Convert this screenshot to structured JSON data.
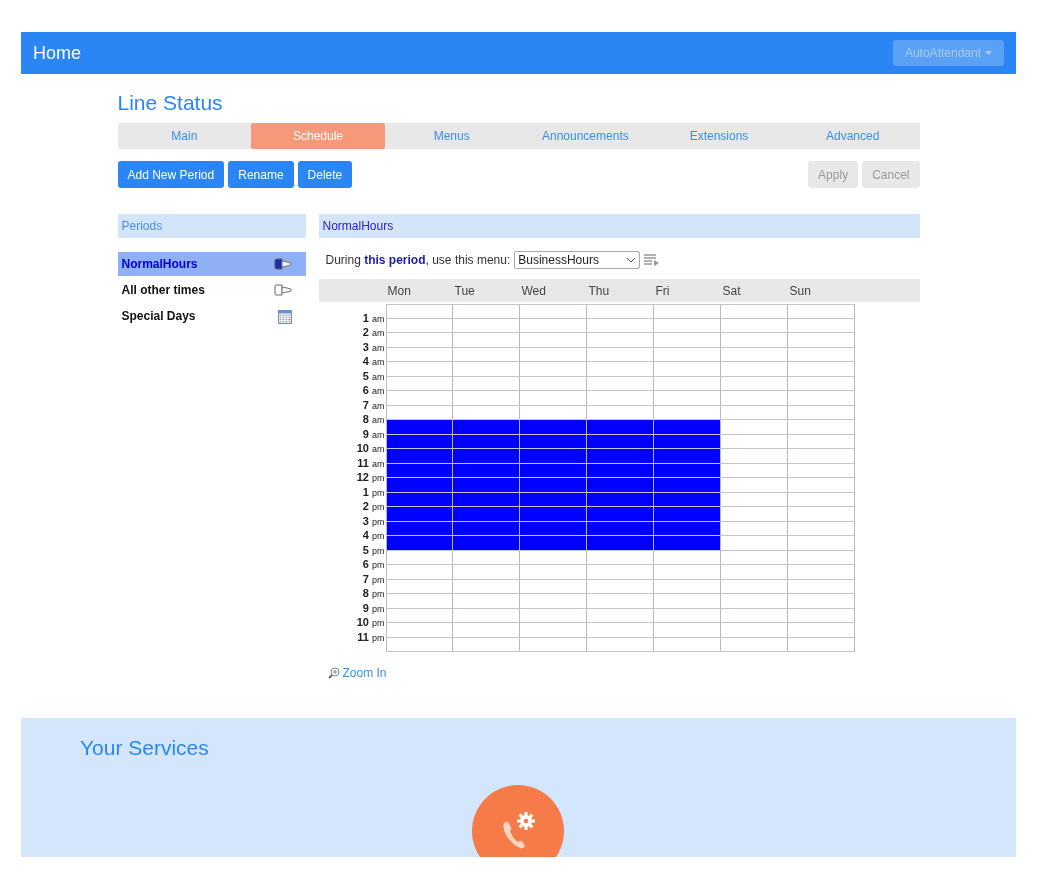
{
  "topbar": {
    "title": "Home",
    "menu": "AutoAttendant"
  },
  "page_title": "Line Status",
  "tabs": [
    {
      "label": "Main",
      "selected": false
    },
    {
      "label": "Schedule",
      "selected": true
    },
    {
      "label": "Menus",
      "selected": false
    },
    {
      "label": "Announcements",
      "selected": false
    },
    {
      "label": "Extensions",
      "selected": false
    },
    {
      "label": "Advanced",
      "selected": false
    }
  ],
  "actions": [
    {
      "label": "Add New Period",
      "disabled": false
    },
    {
      "label": "Rename",
      "disabled": false
    },
    {
      "label": "Delete",
      "disabled": false
    }
  ],
  "form_buttons": [
    {
      "label": "Apply",
      "disabled": true
    },
    {
      "label": "Cancel",
      "disabled": true
    }
  ],
  "periods": {
    "header": "Periods",
    "items": [
      {
        "label": "NormalHours",
        "kind": "brush",
        "selected": true
      },
      {
        "label": "All other times",
        "kind": "brush",
        "selected": false
      },
      {
        "label": "Special Days",
        "kind": "calendar",
        "selected": false
      }
    ]
  },
  "period_panel": {
    "header": "NormalHours",
    "sentence": "During **this period**, use this menu:",
    "menu_value": "BusinessHours"
  },
  "schedule": {
    "hours": [
      {
        "num": "1",
        "suffix": "am"
      },
      {
        "num": "2",
        "suffix": "am"
      },
      {
        "num": "3",
        "suffix": "am"
      },
      {
        "num": "4",
        "suffix": "am"
      },
      {
        "num": "5",
        "suffix": "am"
      },
      {
        "num": "6",
        "suffix": "am"
      },
      {
        "num": "7",
        "suffix": "am"
      },
      {
        "num": "8",
        "suffix": "am"
      },
      {
        "num": "9",
        "suffix": "am"
      },
      {
        "num": "10",
        "suffix": "am"
      },
      {
        "num": "11",
        "suffix": "am"
      },
      {
        "num": "12",
        "suffix": "pm"
      },
      {
        "num": "1",
        "suffix": "pm"
      },
      {
        "num": "2",
        "suffix": "pm"
      },
      {
        "num": "3",
        "suffix": "pm"
      },
      {
        "num": "4",
        "suffix": "pm"
      },
      {
        "num": "5",
        "suffix": "pm"
      },
      {
        "num": "6",
        "suffix": "pm"
      },
      {
        "num": "7",
        "suffix": "pm"
      },
      {
        "num": "8",
        "suffix": "pm"
      },
      {
        "num": "9",
        "suffix": "pm"
      },
      {
        "num": "10",
        "suffix": "pm"
      },
      {
        "num": "11",
        "suffix": "pm"
      }
    ],
    "days": [
      {
        "label": "Mon",
        "slots": [
          false,
          false,
          false,
          false,
          false,
          false,
          false,
          false,
          true,
          true,
          true,
          true,
          true,
          true,
          true,
          true,
          true,
          false,
          false,
          false,
          false,
          false,
          false,
          false
        ]
      },
      {
        "label": "Tue",
        "slots": [
          false,
          false,
          false,
          false,
          false,
          false,
          false,
          false,
          true,
          true,
          true,
          true,
          true,
          true,
          true,
          true,
          true,
          false,
          false,
          false,
          false,
          false,
          false,
          false
        ]
      },
      {
        "label": "Wed",
        "slots": [
          false,
          false,
          false,
          false,
          false,
          false,
          false,
          false,
          true,
          true,
          true,
          true,
          true,
          true,
          true,
          true,
          true,
          false,
          false,
          false,
          false,
          false,
          false,
          false
        ]
      },
      {
        "label": "Thu",
        "slots": [
          false,
          false,
          false,
          false,
          false,
          false,
          false,
          false,
          true,
          true,
          true,
          true,
          true,
          true,
          true,
          true,
          true,
          false,
          false,
          false,
          false,
          false,
          false,
          false
        ]
      },
      {
        "label": "Fri",
        "slots": [
          false,
          false,
          false,
          false,
          false,
          false,
          false,
          false,
          true,
          true,
          true,
          true,
          true,
          true,
          true,
          true,
          true,
          false,
          false,
          false,
          false,
          false,
          false,
          false
        ]
      },
      {
        "label": "Sat",
        "slots": [
          false,
          false,
          false,
          false,
          false,
          false,
          false,
          false,
          false,
          false,
          false,
          false,
          false,
          false,
          false,
          false,
          false,
          false,
          false,
          false,
          false,
          false,
          false,
          false
        ]
      },
      {
        "label": "Sun",
        "slots": [
          false,
          false,
          false,
          false,
          false,
          false,
          false,
          false,
          false,
          false,
          false,
          false,
          false,
          false,
          false,
          false,
          false,
          false,
          false,
          false,
          false,
          false,
          false,
          false
        ]
      }
    ]
  },
  "zoom_link": "Zoom In",
  "services": {
    "title": "Your Services"
  }
}
